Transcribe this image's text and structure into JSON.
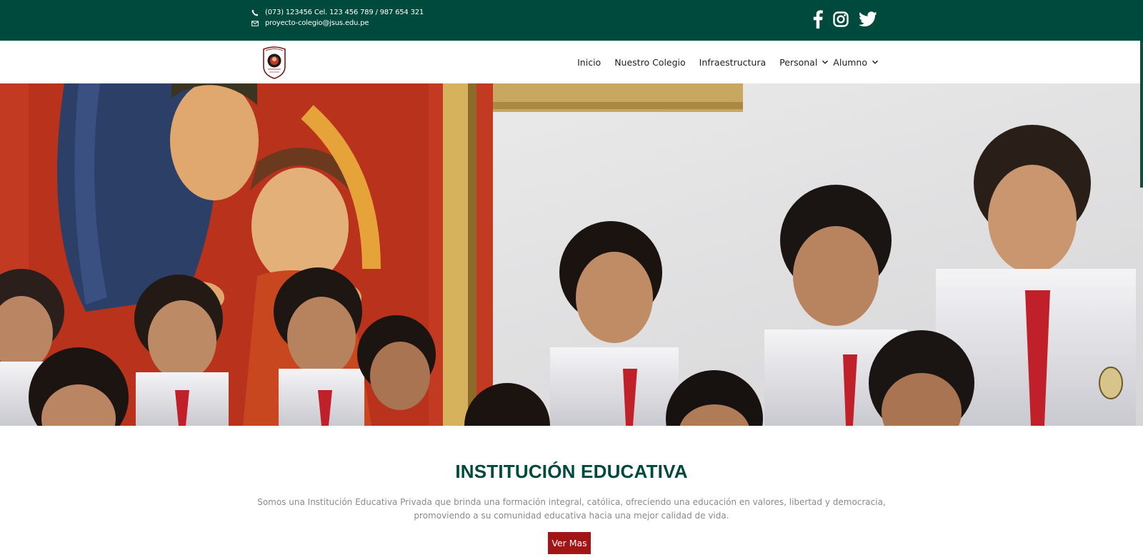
{
  "topbar": {
    "phone": "(073) 123456 Cel. 123 456 789 / 987 654 321",
    "email": "proyecto-colegio@jsus.edu.pe",
    "phone_icon": "phone-icon",
    "email_icon": "envelope-icon",
    "social": [
      "facebook-icon",
      "instagram-icon",
      "twitter-icon"
    ],
    "background": "#004a3d"
  },
  "nav": {
    "logo": "school-crest-logo",
    "items": [
      {
        "label": "Inicio",
        "submenu": false
      },
      {
        "label": "Nuestro Colegio",
        "submenu": false
      },
      {
        "label": "Infraestructura",
        "submenu": false
      },
      {
        "label": "Personal",
        "submenu": true
      },
      {
        "label": "Alumno",
        "submenu": true
      }
    ]
  },
  "hero": {
    "image": "students-photo"
  },
  "main": {
    "title": "INSTITUCIÓN EDUCATIVA",
    "description": "Somos una Institución Educativa Privada que brinda una formación integral, católica, ofreciendo una educación en valores, libertad y democracia, promoviendo a su comunidad educativa hacia una mejor calidad de vida.",
    "button_label": "Ver Mas"
  },
  "colors": {
    "brand_green": "#004a3d",
    "button_red": "#a31515"
  }
}
